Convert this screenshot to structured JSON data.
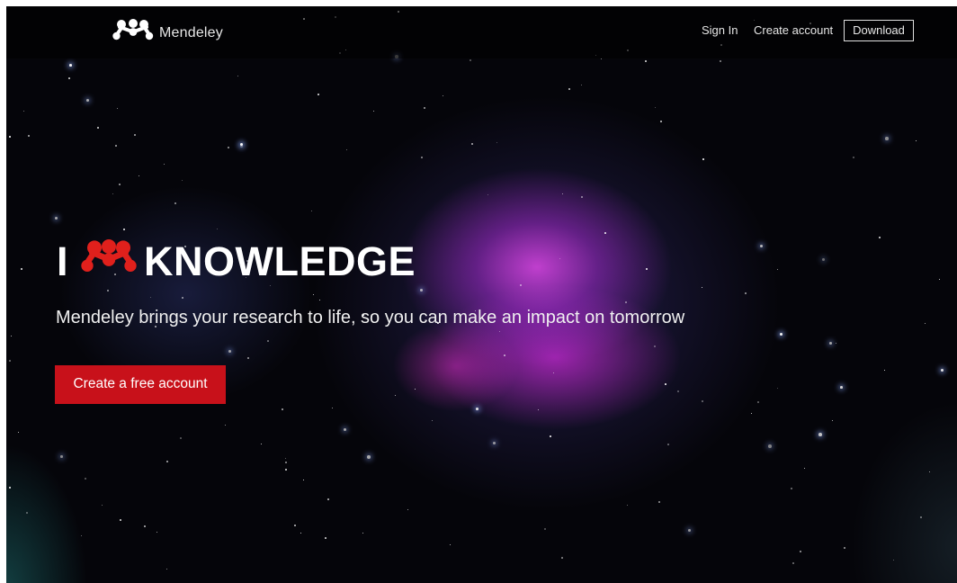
{
  "header": {
    "brand": "Mendeley",
    "sign_in": "Sign In",
    "create_account": "Create account",
    "download": "Download"
  },
  "hero": {
    "headline_prefix": "I",
    "headline_suffix": "KNOWLEDGE",
    "subtitle": "Mendeley brings your research to life, so you can make an impact on tomorrow",
    "cta_label": "Create a free account"
  },
  "icons": {
    "brand_logo": "mendeley-logo-icon",
    "headline_logo": "mendeley-heart-logo-icon"
  },
  "colors": {
    "cta_background": "#c8111a",
    "headline_logo": "#e0201c",
    "text": "#ffffff"
  }
}
